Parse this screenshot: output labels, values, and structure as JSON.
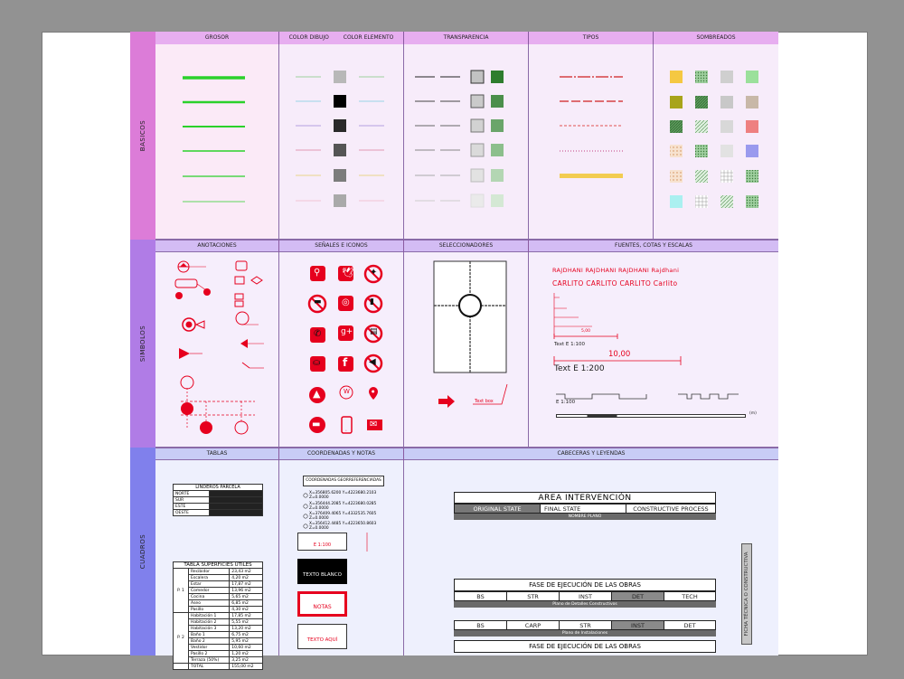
{
  "sections": {
    "basicos": "BASICOS",
    "simbolos": "SIMBOLOS",
    "cuadros": "CUADROS"
  },
  "headers": {
    "grosor": "GROSOR",
    "color_dibujo": "COLOR DIBUJO",
    "color_elemento": "COLOR ELEMENTO",
    "transparencia": "TRANSPARENCIA",
    "tipos": "TIPOS",
    "sombreados": "SOMBREADOS",
    "anotaciones": "ANOTACIONES",
    "senales": "SEÑALES E ICONOS",
    "seleccionadores": "SELECCIONADORES",
    "fuentes": "FUENTES, COTAS Y ESCALAS",
    "tablas": "TABLAS",
    "coordenadas": "COORDENADAS Y NOTAS",
    "cabeceras": "CABECERAS Y LEYENDAS"
  },
  "fonts_panel": {
    "sample1": "RAJDHANI RAJDHANI RAJDHANI Rajdhani",
    "sample2": "CARLITO CARLITO CARLITO Carlito",
    "dim_small": "5,00",
    "text_small": "Text E 1:100",
    "dim_large": "10,00",
    "text_large": "Text E 1:200",
    "scale_label": "E 1:100",
    "scale_unit": "(m)"
  },
  "selector": {
    "text_box": "Text box"
  },
  "linderos": {
    "title": "LINDEROS PARCELA",
    "rows": [
      "NORTE",
      "SUR",
      "ESTE",
      "OESTE"
    ]
  },
  "superficies": {
    "title": "TABLA SUPERFICIES ÚTILES",
    "p1": "P. 1",
    "p2": "P. 2",
    "rows1": [
      [
        "Recibidor",
        "23,43 m2"
      ],
      [
        "Escalera",
        "4,20 m2"
      ],
      [
        "Estar",
        "17,87 m2"
      ],
      [
        "Comedor",
        "13,96 m2"
      ],
      [
        "Cocina",
        "5,65 m2"
      ],
      [
        "Aseo",
        "6,85 m2"
      ],
      [
        "Pasillo",
        "4,30 m2"
      ]
    ],
    "rows2": [
      [
        "Habitación 1",
        "17,85 m2"
      ],
      [
        "Habitación 2",
        "5,55 m2"
      ],
      [
        "Habitación 3",
        "13,20 m2"
      ],
      [
        "Baño 1",
        "6,75 m2"
      ],
      [
        "Baño 2",
        "5,95 m2"
      ],
      [
        "Vestidor",
        "10,60 m2"
      ],
      [
        "Pasillo 2",
        "1,20 m2"
      ],
      [
        "Terraza (50%)",
        "3,25 m2"
      ]
    ],
    "total_label": "TOTAL",
    "total_value": "155,00 m2"
  },
  "coords": {
    "title": "COORDENADAS GEORREFERENCIADAS",
    "lines": [
      "X=356805.6200  Y=4223680.2103  Z=0.0000",
      "X=356444.2085  Y=4223680.0285  Z=0.0000",
      "X=376409.4065  Y=4332535.7605  Z=0.0000",
      "X=356412.4485  Y=4223650.8603  Z=0.0000"
    ],
    "scale_note": "E 1:100",
    "note1": "TEXTO BLANCO AQUÍ",
    "note2": "NOTAS",
    "note3": "TEXTO AQUÍ"
  },
  "title_blocks": {
    "area": "AREA  INTERVENCIÓN",
    "original": "ORIGINAL STATE",
    "final": "FINAL STATE",
    "constructive": "CONSTRUCTIVE PROCESS",
    "nombre_plano": "NOMBRE PLANO",
    "fase1_title": "FASE DE EJECUCIÓN DE LAS OBRAS",
    "fase1_cells": [
      "BS",
      "STR",
      "INST",
      "DET",
      "TECH"
    ],
    "fase1_sub": "Plano de Detalles Constructivos",
    "fase2_title": "FASE DE EJECUCIÓN DE LAS OBRAS",
    "fase2_cells": [
      "BS",
      "CARP",
      "STR",
      "INST",
      "DET"
    ],
    "fase2_sub": "Plano de Instalaciones",
    "vertical": "FICHA TÉCNICA O CONSTRUCTIVA"
  },
  "colors": {
    "basicos_band": "#dc7cd8",
    "simbolos_band": "#b07ce6",
    "cuadros_band": "#8080ec",
    "accent_red": "#e6001e"
  },
  "icons": [
    "bicycle-icon",
    "twitter-icon",
    "no-pedestrian-icon",
    "no-smoking-icon",
    "instagram-icon",
    "no-entry-icon",
    "phone-icon",
    "google-plus-icon",
    "no-phone-icon",
    "bathtub-icon",
    "facebook-icon",
    "no-sound-icon",
    "tripod-icon",
    "web-icon",
    "map-pin-icon",
    "no-entry-road-icon",
    "mobile-icon",
    "mail-icon"
  ]
}
